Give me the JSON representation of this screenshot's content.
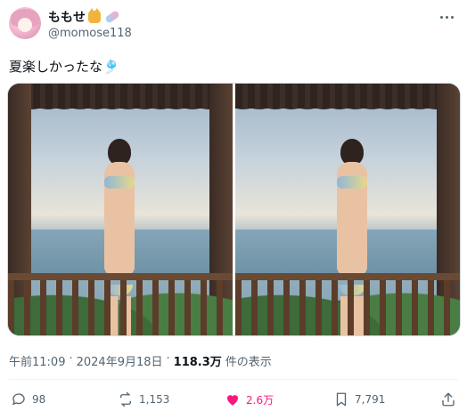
{
  "user": {
    "display_name": "ももせ",
    "handle": "@momose118",
    "name_emoji": [
      "cat-emoji",
      "candy-emoji"
    ]
  },
  "tweet": {
    "text": "夏楽しかったな🎐",
    "time": "午前11:09",
    "separator": "·",
    "date": "2024年9月18日",
    "views_count": "118.3万",
    "views_label": "件の表示"
  },
  "media": {
    "count": 2
  },
  "actions": {
    "reply_count": "98",
    "repost_count": "1,153",
    "like_count": "2.6万",
    "bookmark_count": "7,791",
    "liked": true
  },
  "icons": {
    "more": "more-icon",
    "reply": "reply-icon",
    "repost": "repost-icon",
    "like": "heart-icon",
    "bookmark": "bookmark-icon",
    "share": "share-icon"
  },
  "colors": {
    "text": "#0f1419",
    "secondary": "#536471",
    "like_active": "#f91880",
    "border": "#cfd9de"
  }
}
